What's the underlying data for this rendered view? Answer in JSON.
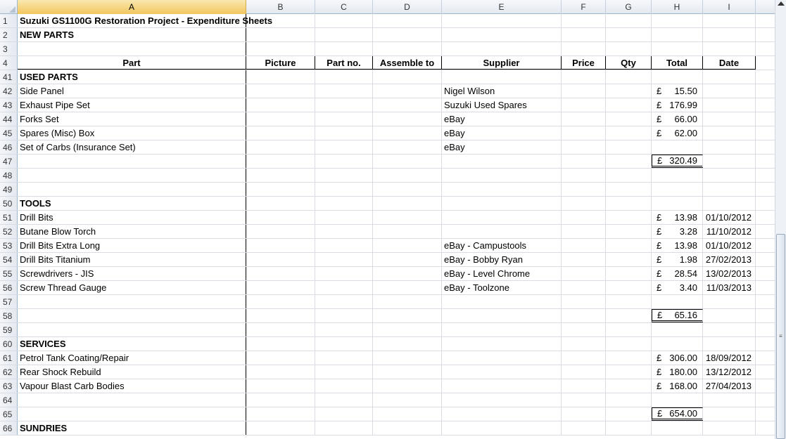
{
  "columns": [
    "A",
    "B",
    "C",
    "D",
    "E",
    "F",
    "G",
    "H",
    "I"
  ],
  "selected_column": "A",
  "rows": [
    {
      "n": "1",
      "a": "Suzuki GS1100G Restoration Project - Expenditure Sheets",
      "bold": true
    },
    {
      "n": "2",
      "a": "NEW PARTS",
      "bold": true
    },
    {
      "n": "3",
      "a": ""
    },
    {
      "n": "4",
      "header": true
    },
    {
      "n": "41",
      "a": "USED PARTS",
      "bold": true
    },
    {
      "n": "42",
      "a": "Side Panel",
      "e": "Nigel Wilson",
      "h": "15.50"
    },
    {
      "n": "43",
      "a": "Exhaust Pipe Set",
      "e": "Suzuki Used Spares",
      "h": "176.99"
    },
    {
      "n": "44",
      "a": "Forks Set",
      "e": "eBay",
      "h": "66.00"
    },
    {
      "n": "45",
      "a": "Spares (Misc) Box",
      "e": "eBay",
      "h": "62.00"
    },
    {
      "n": "46",
      "a": "Set of Carbs (Insurance Set)",
      "e": "eBay"
    },
    {
      "n": "47",
      "a": "",
      "h": "320.49",
      "total": true
    },
    {
      "n": "48",
      "a": ""
    },
    {
      "n": "49",
      "a": ""
    },
    {
      "n": "50",
      "a": "TOOLS",
      "bold": true
    },
    {
      "n": "51",
      "a": "Drill Bits",
      "h": "13.98",
      "i": "01/10/2012"
    },
    {
      "n": "52",
      "a": "Butane Blow Torch",
      "h": "3.28",
      "i": "11/10/2012"
    },
    {
      "n": "53",
      "a": "Drill Bits Extra Long",
      "e": "eBay - Campustools",
      "h": "13.98",
      "i": "01/10/2012"
    },
    {
      "n": "54",
      "a": "Drill Bits Titanium",
      "e": "eBay - Bobby Ryan",
      "h": "1.98",
      "i": "27/02/2013"
    },
    {
      "n": "55",
      "a": "Screwdrivers - JIS",
      "e": "eBay - Level Chrome",
      "h": "28.54",
      "i": "13/02/2013"
    },
    {
      "n": "56",
      "a": "Screw Thread Gauge",
      "e": "eBay - Toolzone",
      "h": "3.40",
      "i": "11/03/2013"
    },
    {
      "n": "57",
      "a": ""
    },
    {
      "n": "58",
      "a": "",
      "h": "65.16",
      "total": true
    },
    {
      "n": "59",
      "a": ""
    },
    {
      "n": "60",
      "a": "SERVICES",
      "bold": true
    },
    {
      "n": "61",
      "a": "Petrol Tank Coating/Repair",
      "h": "306.00",
      "i": "18/09/2012"
    },
    {
      "n": "62",
      "a": "Rear Shock Rebuild",
      "h": "180.00",
      "i": "13/12/2012"
    },
    {
      "n": "63",
      "a": "Vapour Blast Carb Bodies",
      "h": "168.00",
      "i": "27/04/2013"
    },
    {
      "n": "64",
      "a": ""
    },
    {
      "n": "65",
      "a": "",
      "h": "654.00",
      "total": true
    },
    {
      "n": "66",
      "a": "SUNDRIES",
      "bold": true
    }
  ],
  "header_row": {
    "a": "Part",
    "b": "Picture",
    "c": "Part no.",
    "d": "Assemble to",
    "e": "Supplier",
    "f": "Price",
    "g": "Qty",
    "h": "Total",
    "i": "Date"
  },
  "currency_symbol": "£"
}
